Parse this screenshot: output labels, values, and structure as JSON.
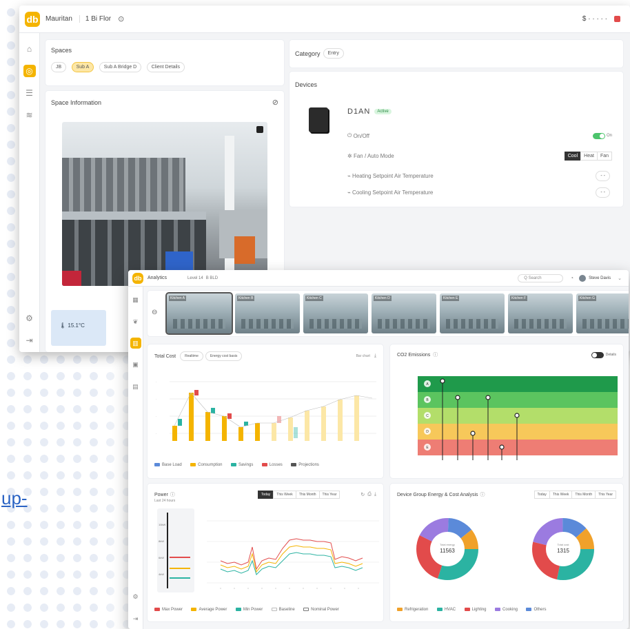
{
  "page": {
    "edge_text": "up-"
  },
  "w1": {
    "brand": "db",
    "title": "Mauritan",
    "floor": "1  Bi Flor",
    "right_text": "$  ·  ·  ·  ·  ·",
    "spaces_title": "Spaces",
    "spaces": [
      "JB",
      "Sub A",
      "Sub A Bridge D",
      "Client Details"
    ],
    "category_label": "Category",
    "category_value": "Entry",
    "space_info_title": "Space Information",
    "badge_temp": "15.1°C",
    "devices_title": "Devices",
    "device": {
      "name": "D1AN",
      "status": "Active",
      "power_label": "On/Off",
      "mode_label": "Fan / Auto Mode",
      "mode_options": [
        "Cool",
        "Heat",
        "Fan"
      ],
      "heating_label": "Heating Setpoint Air Temperature",
      "cooling_label": "Cooling Setpoint Air Temperature",
      "heating_value": "- -",
      "cooling_value": "- -",
      "toggle_text": "On"
    }
  },
  "w2": {
    "brand": "db",
    "title": "Analytics",
    "crumbs": [
      "Level 14",
      "B BLD"
    ],
    "search_placeholder": "Q  Search",
    "user": "Steve Davis",
    "cameras": [
      "Kitchen A",
      "Kitchen B",
      "Kitchen C",
      "Kitchen D",
      "Kitchen E",
      "Kitchen F",
      "Kitchen G"
    ],
    "total_cost": {
      "title": "Total Cost",
      "filters": [
        "Realtime",
        "Energy cost basis"
      ],
      "right_label": "Bar chart",
      "legend": [
        "Base Load",
        "Consumption",
        "Savings",
        "Losses",
        "Projections"
      ]
    },
    "co2": {
      "title": "CO2 Emissions",
      "toggle_label": "Details",
      "levels": [
        "A",
        "B",
        "C",
        "D",
        "E"
      ]
    },
    "power": {
      "title": "Power",
      "subtitle": "Last 24 hours",
      "tabs": [
        "Today",
        "This Week",
        "This Month",
        "This Year"
      ],
      "legend": [
        "Max Power",
        "Average Power",
        "Min Power",
        "Baseline",
        "Nominal Power"
      ],
      "gauge_labels": [
        "10kW",
        "8kW",
        "6kW",
        "4kW",
        "2kW"
      ]
    },
    "group": {
      "title": "Device Group Energy & Cost Analysis",
      "tabs": [
        "Today",
        "This Week",
        "This Month",
        "This Year"
      ],
      "donut1_center_label": "Total energy",
      "donut1_center_value": "11563",
      "donut2_center_label": "Total cost",
      "donut2_center_value": "1315",
      "legend": [
        "Refrigeration",
        "HVAC",
        "Lighting",
        "Cooking",
        "Others"
      ]
    }
  },
  "colors": {
    "accent": "#f4b400",
    "green": "#4cc46c",
    "teal": "#2bb3a2",
    "red": "#e24b4b",
    "purple": "#9b7be0"
  }
}
